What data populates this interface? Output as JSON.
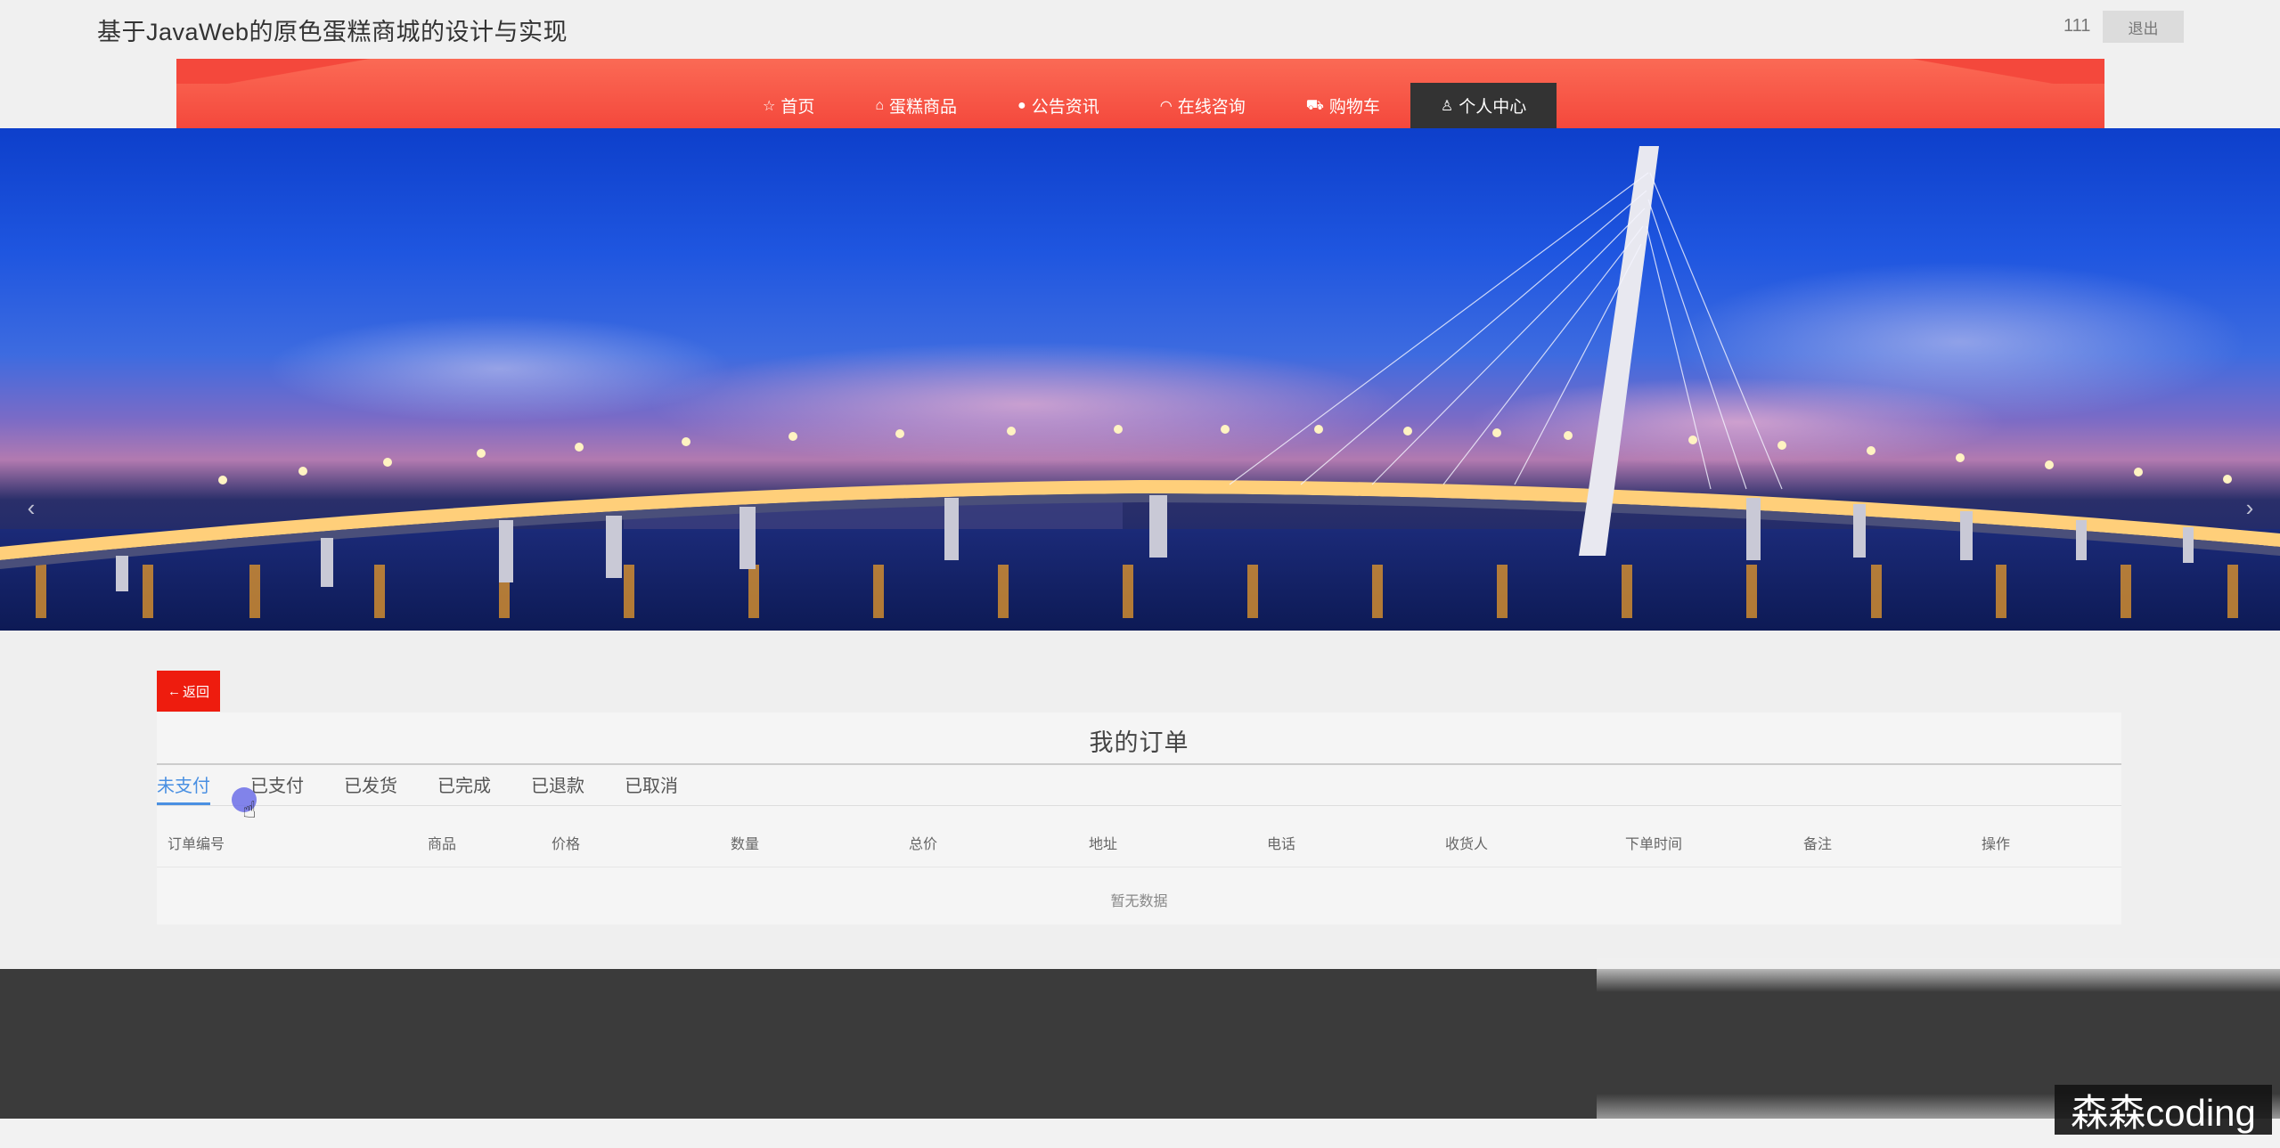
{
  "header": {
    "site_title": "基于JavaWeb的原色蛋糕商城的设计与实现",
    "user_name": "111",
    "logout_label": "退出"
  },
  "nav": {
    "items": [
      {
        "label": "首页",
        "icon": "star-icon"
      },
      {
        "label": "蛋糕商品",
        "icon": "bag-icon"
      },
      {
        "label": "公告资讯",
        "icon": "info-icon"
      },
      {
        "label": "在线咨询",
        "icon": "headset-icon"
      },
      {
        "label": "购物车",
        "icon": "cart-icon"
      },
      {
        "label": "个人中心",
        "icon": "user-icon"
      }
    ],
    "active_index": 5
  },
  "banner": {
    "prev_arrow": "‹",
    "next_arrow": "›"
  },
  "orders": {
    "back_label": "返回",
    "title": "我的订单",
    "tabs": [
      "未支付",
      "已支付",
      "已发货",
      "已完成",
      "已退款",
      "已取消"
    ],
    "active_tab": 0,
    "columns": [
      "订单编号",
      "商品",
      "价格",
      "数量",
      "总价",
      "地址",
      "电话",
      "收货人",
      "下单时间",
      "备注",
      "操作"
    ],
    "empty_text": "暂无数据"
  },
  "watermark": "森森coding",
  "colors": {
    "nav_red": "#f4483c",
    "nav_active": "#333333",
    "back_red": "#ee1c0e",
    "tab_active": "#4a90e2",
    "footer": "#3b3b3b"
  }
}
